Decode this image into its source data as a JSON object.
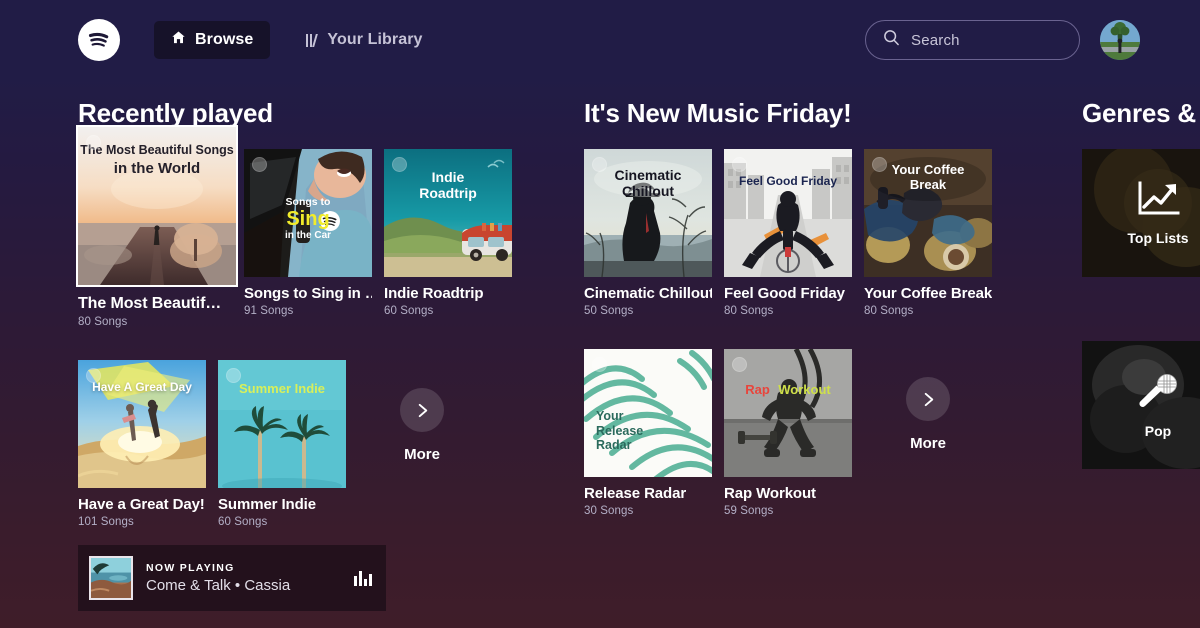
{
  "header": {
    "logo_icon": "spotify-logo-icon",
    "browse": {
      "label": "Browse",
      "icon": "home-icon"
    },
    "library": {
      "label": "Your Library",
      "icon": "library-bars-icon"
    },
    "search": {
      "placeholder": "Search",
      "icon": "search-icon"
    },
    "avatar_alt": "user-avatar"
  },
  "sections": [
    {
      "title": "Recently played",
      "rows": [
        {
          "cards": [
            {
              "title": "The Most Beautif…",
              "songs": "80 Songs",
              "art_title_line1": "The Most Beautiful Songs",
              "art_title_line2": "in the World",
              "focused": true
            },
            {
              "title": "Songs to Sing in …",
              "songs": "91 Songs",
              "art_title_line1": "Songs to",
              "art_title_line2": "Sing",
              "art_title_line3": "in the Car",
              "focused": false
            },
            {
              "title": "Indie Roadtrip",
              "songs": "60 Songs",
              "art_title_line1": "Indie",
              "art_title_line2": "Roadtrip",
              "focused": false
            }
          ],
          "more": null
        },
        {
          "cards": [
            {
              "title": "Have a Great Day!",
              "songs": "101 Songs",
              "art_title_line1": "Have A Great Day",
              "focused": false
            },
            {
              "title": "Summer Indie",
              "songs": "60 Songs",
              "art_title_line1": "Summer Indie",
              "focused": false
            }
          ],
          "more": {
            "label": "More",
            "icon": "chevron-right-icon"
          }
        }
      ]
    },
    {
      "title": "It's New Music Friday!",
      "rows": [
        {
          "cards": [
            {
              "title": "Cinematic Chillout",
              "songs": "50 Songs",
              "art_title_line1": "Cinematic",
              "art_title_line2": "Chillout",
              "focused": false
            },
            {
              "title": "Feel Good Friday",
              "songs": "80 Songs",
              "art_title_line1": "Feel Good Friday",
              "focused": false
            },
            {
              "title": "Your Coffee Break",
              "songs": "80 Songs",
              "art_title_line1": "Your Coffee",
              "art_title_line2": "Break",
              "focused": false
            }
          ],
          "more": null
        },
        {
          "cards": [
            {
              "title": "Release Radar",
              "songs": "30 Songs",
              "art_title_line1": "Your",
              "art_title_line2": "Release",
              "art_title_line3": "Radar",
              "focused": false
            },
            {
              "title": "Rap Workout",
              "songs": "59 Songs",
              "art_title_line1": "Rap",
              "art_title_line2": "Workout",
              "focused": false
            }
          ],
          "more": {
            "label": "More",
            "icon": "chevron-right-icon"
          }
        }
      ]
    }
  ],
  "genres": {
    "title": "Genres & M",
    "tiles": [
      {
        "label": "Top Lists",
        "icon": "trending-chart-icon"
      },
      {
        "label": "Pop",
        "icon": "microphone-icon"
      }
    ]
  },
  "now_playing": {
    "label": "NOW PLAYING",
    "track": "Come & Talk • Cassia",
    "eq_icon": "equalizer-icon"
  },
  "colors": {
    "bg_top": "#211c46",
    "bg_bottom": "#3f1d29",
    "accent_white": "#ffffff",
    "browse_chip": "#161229",
    "nowplaying_bg": "#23111c",
    "muted_text": "#b4b0c7"
  }
}
